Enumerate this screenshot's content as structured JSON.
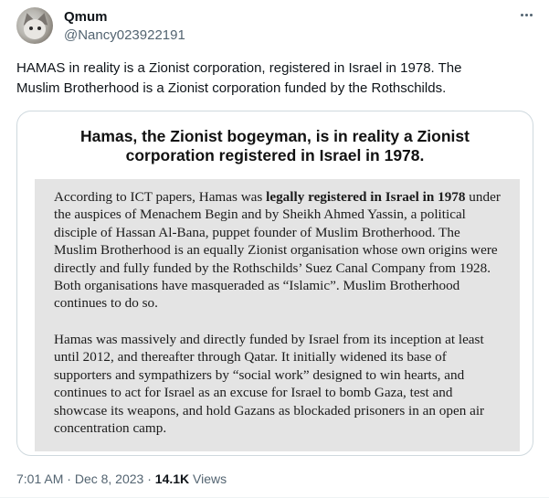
{
  "author": {
    "display_name": "Qmum",
    "handle": "@Nancy023922191",
    "avatar_icon": "cat-photo-avatar"
  },
  "tweet": {
    "text_line1": "HAMAS in reality is a Zionist corporation, registered in Israel in 1978.  The",
    "text_line2": "Muslim Brotherhood is a Zionist corporation funded by the Rothschilds."
  },
  "media": {
    "heading_line1": "Hamas, the Zionist bogeyman, is in reality a Zionist",
    "heading_line2": "corporation registered in Israel in 1978.",
    "p1_a": "According to ICT papers, Hamas was ",
    "p1_bold": "legally registered in Israel in 1978",
    "p1_b": " under the auspices of Menachem Begin and by Sheikh Ahmed Yassin, a political disciple of Hassan Al-Bana, puppet founder of Muslim Brotherhood. The Muslim Brotherhood is an equally Zionist organisation whose own origins were directly and fully funded by the Rothschilds’ Suez Canal Company from 1928. Both organisations have masqueraded as “Islamic”. Muslim Brotherhood continues to do so.",
    "p2": "Hamas was massively and directly funded by Israel from its inception at least until 2012, and thereafter through Qatar. It initially widened its base of supporters and sympathizers by “social work” designed to win hearts, and continues to act for Israel as an excuse for Israel to bomb Gaza, test and showcase its weapons, and hold Gazans as blockaded prisoners in an open air concentration camp."
  },
  "meta": {
    "time": "7:01 AM",
    "separator": " · ",
    "date": "Dec 8, 2023",
    "views_count": "14.1K",
    "views_label": " Views"
  },
  "colors": {
    "text_primary": "#0f1419",
    "text_secondary": "#536471",
    "border": "#cfd9de",
    "media_box": "#e4e4e4"
  }
}
